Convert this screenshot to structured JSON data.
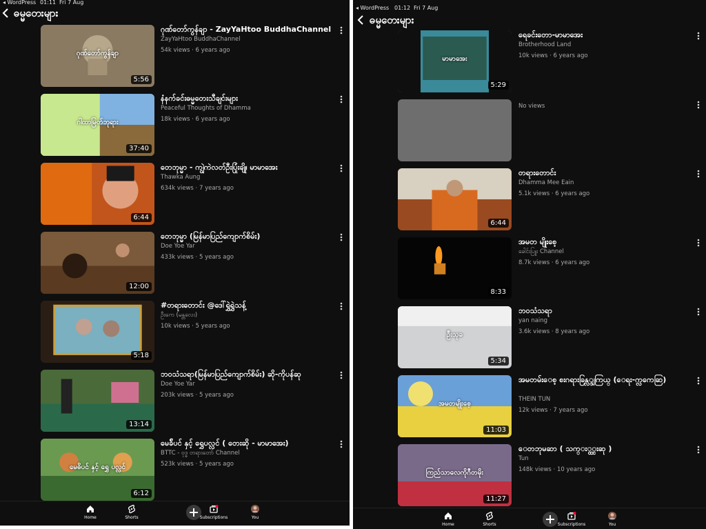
{
  "left": {
    "status": {
      "carrier": "◂ WordPress",
      "time": "01:11",
      "date": "Fri 7 Aug"
    },
    "title": "ဓမ္မတေးများ",
    "back_icon": "chevron-left-icon",
    "videos": [
      {
        "title": "ဂုဏ်တော်ကွန်ချာ - ZayYaHtoo BuddhaChannel",
        "channel": "ZayYaHtoo BuddhaChannel",
        "meta": "54k views · 6 years ago",
        "duration": "5:56",
        "thumb_text": "ဂုဏ်တော်ကွန်ချာ",
        "bg": "#8a7a62"
      },
      {
        "title": "နံနက်ခင်းဓမ္မတေးသီချင်းများ",
        "channel": "Peaceful Thoughts of Dhamma",
        "meta": "18k views · 6 years ago",
        "duration": "37:40",
        "thumb_text": "ဂါထာမြတ်ဘုရား",
        "bg": "#b9d97a"
      },
      {
        "title": "တေဘုမ္မာ - ကျွဲကဲလတ်ဦးပြုံးချို၊ မာမာအေး",
        "channel": "Thawka Aung",
        "meta": "634k views · 7 years ago",
        "duration": "6:44",
        "thumb_text": "",
        "bg": "#c2551b"
      },
      {
        "title": "တေဘုမ္မာ (မြန်မာပြည်ကျောက်စိမ်း)",
        "channel": "Doe Yoe Yar",
        "meta": "433k views · 5 years ago",
        "duration": "12:00",
        "thumb_text": "",
        "bg": "#7a5a3a"
      },
      {
        "title": "#တရားတောင်း @ဒေါ်ရွှဲရွှဲသန့်",
        "channel": "ဦးကေ (မန္တလေး)",
        "meta": "10k views · 5 years ago",
        "duration": "5:18",
        "thumb_text": "",
        "bg": "#2a1e14"
      },
      {
        "title": "ဘဝသံသရာ(မြန်မာပြည်ကျောက်စိမ်း) ဆို-ကိုပန်ဆု",
        "channel": "Doe Yoe Yar",
        "meta": "203k views · 5 years ago",
        "duration": "13:14",
        "thumb_text": "",
        "bg": "#4a6a3a"
      },
      {
        "title": "မေခ်ိပင် နှင့် ရွှေပလ္လင် ( တေးဆို - မာမာအေး)",
        "channel": "BTTC - ဗုဒ္ဓ တရားတော် Channel",
        "meta": "523k views · 5 years ago",
        "duration": "6:12",
        "thumb_text": "မေဓိပင် နှင့် ရွှေ ပလ္လင်",
        "bg": "#3a6a30"
      }
    ],
    "nav": [
      {
        "label": "Home",
        "icon": "home-icon"
      },
      {
        "label": "Shorts",
        "icon": "shorts-icon"
      },
      {
        "label": "",
        "icon": "create-plus-icon"
      },
      {
        "label": "Subscriptions",
        "icon": "subscriptions-icon"
      },
      {
        "label": "You",
        "icon": "avatar-icon"
      }
    ]
  },
  "right": {
    "status": {
      "carrier": "◂ WordPress",
      "time": "01:12",
      "date": "Fri 7 Aug"
    },
    "title": "ဓမ္မတေးများ",
    "back_icon": "chevron-left-icon",
    "videos": [
      {
        "title": "ရေခင်းတော-မာမာအေး",
        "channel": "Brotherhood Land",
        "meta": "10k views · 6 years ago",
        "duration": "5:29",
        "thumb_text": "မာမာအေး",
        "bg": "#3a8a9a"
      },
      {
        "title": "",
        "channel": "",
        "meta": "No views",
        "duration": "",
        "thumb_text": "",
        "bg": "#6e6e6e"
      },
      {
        "title": "တရားတောင်း",
        "channel": "Dhamma Mee Eain",
        "meta": "5.1k views · 6 years ago",
        "duration": "6:44",
        "thumb_text": "",
        "bg": "#9a4a20"
      },
      {
        "title": "အမတ မျိုးစေ့",
        "channel": "ခေါင်းပြူး Channel",
        "meta": "8.7k views · 6 years ago",
        "duration": "8:33",
        "thumb_text": "",
        "bg": "#050505"
      },
      {
        "title": "ဘဝသံသရာ",
        "channel": "yan naing",
        "meta": "3.6k views · 8 years ago",
        "duration": "5:34",
        "thumb_text": "ဦးသုခ",
        "bg": "#d0d2d4"
      },
      {
        "title": "အမတမ်း‌ေစ့ စးဂရားခြန္လ္ျကြယ္ (‌ေရး-က္လကေဆြ)",
        "channel": "THEIN TUN",
        "meta": "12k views · 7 years ago",
        "duration": "11:03",
        "thumb_text": "အမတမျိုးစေ့",
        "bg": "#6aa0d8"
      },
      {
        "title": "‌ေတဘုမဆာ ( သက္း္ငွ္ငးဆု )",
        "channel": "Tun",
        "meta": "148k views · 10 years ago",
        "duration": "11:27",
        "thumb_text": "ကြည်သာလေကိုဂီတမိုး",
        "bg": "#3a4a7a"
      }
    ],
    "nav": [
      {
        "label": "Home",
        "icon": "home-icon"
      },
      {
        "label": "Shorts",
        "icon": "shorts-icon"
      },
      {
        "label": "",
        "icon": "create-plus-icon"
      },
      {
        "label": "Subscriptions",
        "icon": "subscriptions-icon"
      },
      {
        "label": "You",
        "icon": "avatar-icon"
      }
    ]
  }
}
